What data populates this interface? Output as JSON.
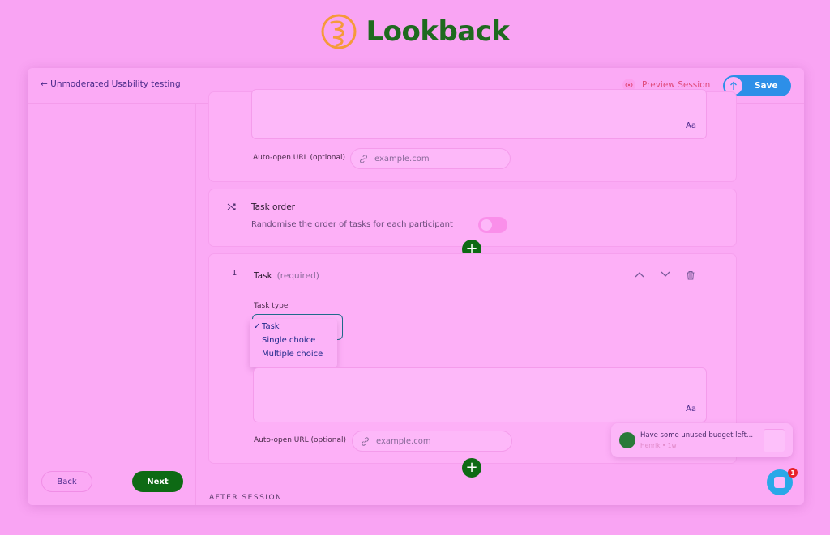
{
  "brand": {
    "name": "Lookback"
  },
  "header": {
    "back_label": "← Unmoderated Usability testing",
    "preview_label": "Preview Session",
    "save_label": "Save"
  },
  "sidebar": {
    "back_label": "Back",
    "next_label": "Next"
  },
  "previous_task": {
    "format_label": "Aa",
    "url_label": "Auto-open URL (optional)",
    "url_placeholder": "example.com"
  },
  "task_order": {
    "title": "Task order",
    "description": "Randomise the order of tasks for each participant",
    "toggle_on": false
  },
  "task": {
    "number": "1",
    "title": "Task",
    "required_label": "(required)",
    "type_label": "Task type",
    "type_options": [
      {
        "check": "✓",
        "label": "Task",
        "selected": true
      },
      {
        "check": "",
        "label": "Single choice",
        "selected": false
      },
      {
        "check": "",
        "label": "Multiple choice",
        "selected": false
      }
    ],
    "format_label": "Aa",
    "url_label": "Auto-open URL (optional)",
    "url_placeholder": "example.com"
  },
  "after_session": {
    "label": "AFTER SESSION"
  },
  "notification": {
    "message": "Have some unused budget left...",
    "meta": "Henrik • 1w"
  },
  "chat": {
    "badge": "1"
  },
  "colors": {
    "background": "#f9a4f3",
    "brand_green": "#1e6a1e",
    "next_button": "#0e6a14",
    "save_button": "#2d8fe8",
    "preview_text": "#e04a7a",
    "badge": "#e8232a"
  }
}
